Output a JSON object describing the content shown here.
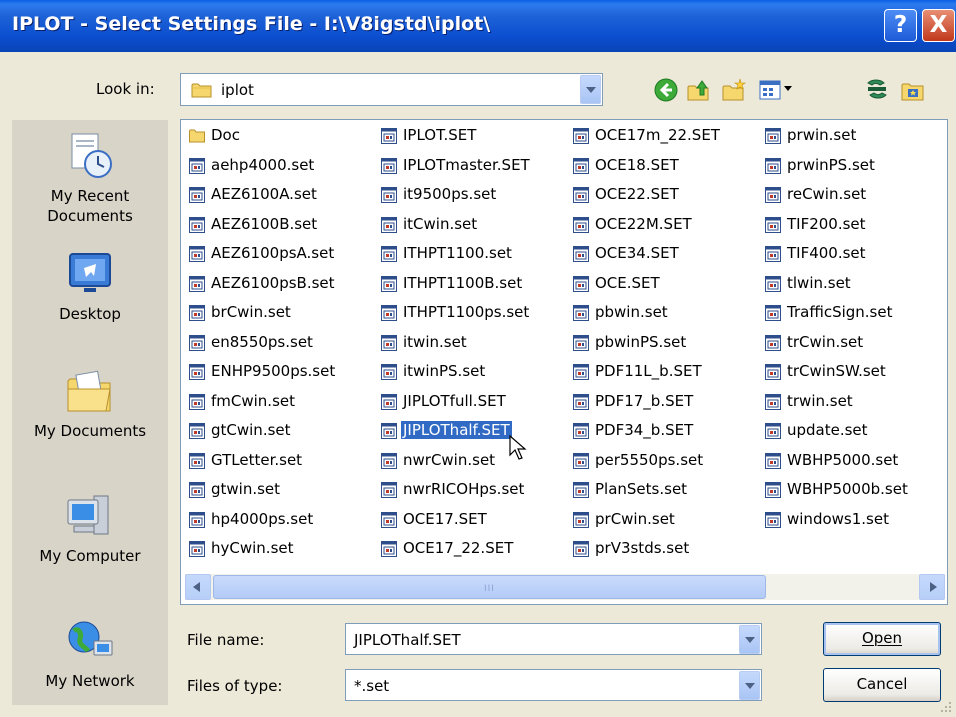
{
  "window": {
    "title": "IPLOT - Select Settings File - I:\\V8igstd\\iplot\\",
    "help_glyph": "?",
    "close_glyph": "X"
  },
  "toolbar": {
    "look_in_label": "Look in:",
    "look_in_value": "iplot",
    "icons": [
      "back-icon",
      "up-folder-icon",
      "new-folder-icon",
      "views-icon",
      "tool-icon",
      "desktop-folder-icon"
    ]
  },
  "places": [
    {
      "label_lines": [
        "My Recent",
        "Documents"
      ],
      "icon": "recent-documents-icon"
    },
    {
      "label_lines": [
        "Desktop"
      ],
      "icon": "desktop-icon"
    },
    {
      "label_lines": [
        "My Documents"
      ],
      "icon": "my-documents-icon"
    },
    {
      "label_lines": [
        "My Computer"
      ],
      "icon": "my-computer-icon"
    },
    {
      "label_lines": [
        "My Network"
      ],
      "icon": "my-network-icon"
    }
  ],
  "files": {
    "columns": [
      [
        "Doc",
        "aehp4000.set",
        "AEZ6100A.set",
        "AEZ6100B.set",
        "AEZ6100psA.set",
        "AEZ6100psB.set",
        "brCwin.set",
        "en8550ps.set",
        "ENHP9500ps.set",
        "fmCwin.set",
        "gtCwin.set",
        "GTLetter.set",
        "gtwin.set",
        "hp4000ps.set",
        "hyCwin.set"
      ],
      [
        "IPLOT.SET",
        "IPLOTmaster.SET",
        "it9500ps.set",
        "itCwin.set",
        "ITHPT1100.set",
        "ITHPT1100B.set",
        "ITHPT1100ps.set",
        "itwin.set",
        "itwinPS.set",
        "JIPLOTfull.SET",
        "JIPLOThalf.SET",
        "nwrCwin.set",
        "nwrRICOHps.set",
        "OCE17.SET",
        "OCE17_22.SET"
      ],
      [
        "OCE17m_22.SET",
        "OCE18.SET",
        "OCE22.SET",
        "OCE22M.SET",
        "OCE34.SET",
        "OCE.SET",
        "pbwin.set",
        "pbwinPS.set",
        "PDF11L_b.SET",
        "PDF17_b.SET",
        "PDF34_b.SET",
        "per5550ps.set",
        "PlanSets.set",
        "prCwin.set",
        "prV3stds.set"
      ],
      [
        "prwin.set",
        "prwinPS.set",
        "reCwin.set",
        "TIF200.set",
        "TIF400.set",
        "tlwin.set",
        "TrafficSign.set",
        "trCwin.set",
        "trCwinSW.set",
        "trwin.set",
        "update.set",
        "WBHP5000.set",
        "WBHP5000b.set",
        "windows1.set"
      ]
    ],
    "selected": "JIPLOThalf.SET",
    "folder_items": [
      "Doc"
    ]
  },
  "scrollbar": {
    "grip": "III"
  },
  "form": {
    "file_name_label": "File name:",
    "file_name_value": "JIPLOThalf.SET",
    "file_type_label": "Files of type:",
    "file_type_value": "*.set",
    "open_label": "Open",
    "cancel_label": "Cancel"
  },
  "colors": {
    "title_bar": "#0B4ED0",
    "selection": "#316AC5",
    "dialog_bg": "#ECE9D8",
    "places_bg": "#D8D4C8"
  }
}
